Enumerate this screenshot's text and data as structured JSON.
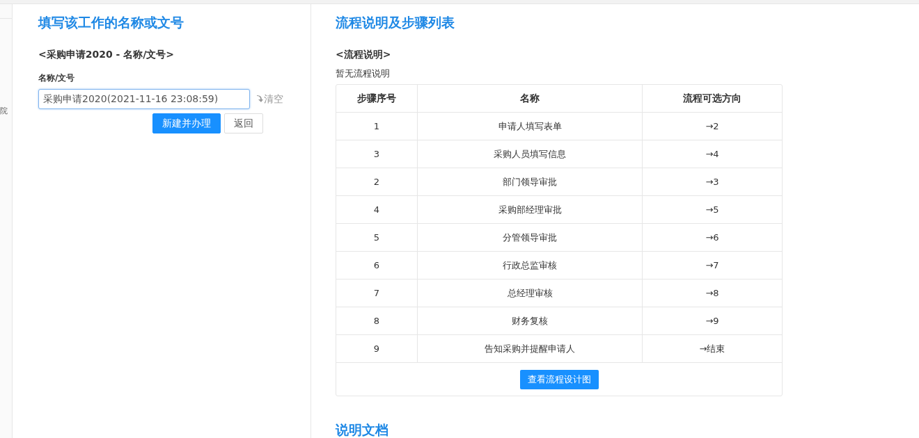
{
  "sidebar": {
    "text": "院"
  },
  "form": {
    "title": "填写该工作的名称或文号",
    "subtitle": "<采购申请2020 - 名称/文号>",
    "field_label": "名称/文号",
    "value": "采购申请2020(2021-11-16 23:08:59)",
    "clear": "清空",
    "buttons": [
      {
        "label": "新建并办理",
        "kind": "primary"
      },
      {
        "label": "返回",
        "kind": "default"
      }
    ]
  },
  "flow": {
    "title": "流程说明及步骤列表",
    "subtitle": "<流程说明>",
    "description": "暂无流程说明",
    "table": {
      "columns": [
        "步骤序号",
        "名称",
        "流程可选方向"
      ],
      "rows": [
        [
          "1",
          "申请人填写表单",
          "→2"
        ],
        [
          "3",
          "采购人员填写信息",
          "→4"
        ],
        [
          "2",
          "部门领导审批",
          "→3"
        ],
        [
          "4",
          "采购部经理审批",
          "→5"
        ],
        [
          "5",
          "分管领导审批",
          "→6"
        ],
        [
          "6",
          "行政总监审核",
          "→7"
        ],
        [
          "7",
          "总经理审核",
          "→8"
        ],
        [
          "8",
          "财务复核",
          "→9"
        ],
        [
          "9",
          "告知采购并提醒申请人",
          "→结束"
        ]
      ]
    },
    "button": "查看流程设计图"
  },
  "docs": {
    "title": "说明文档"
  }
}
